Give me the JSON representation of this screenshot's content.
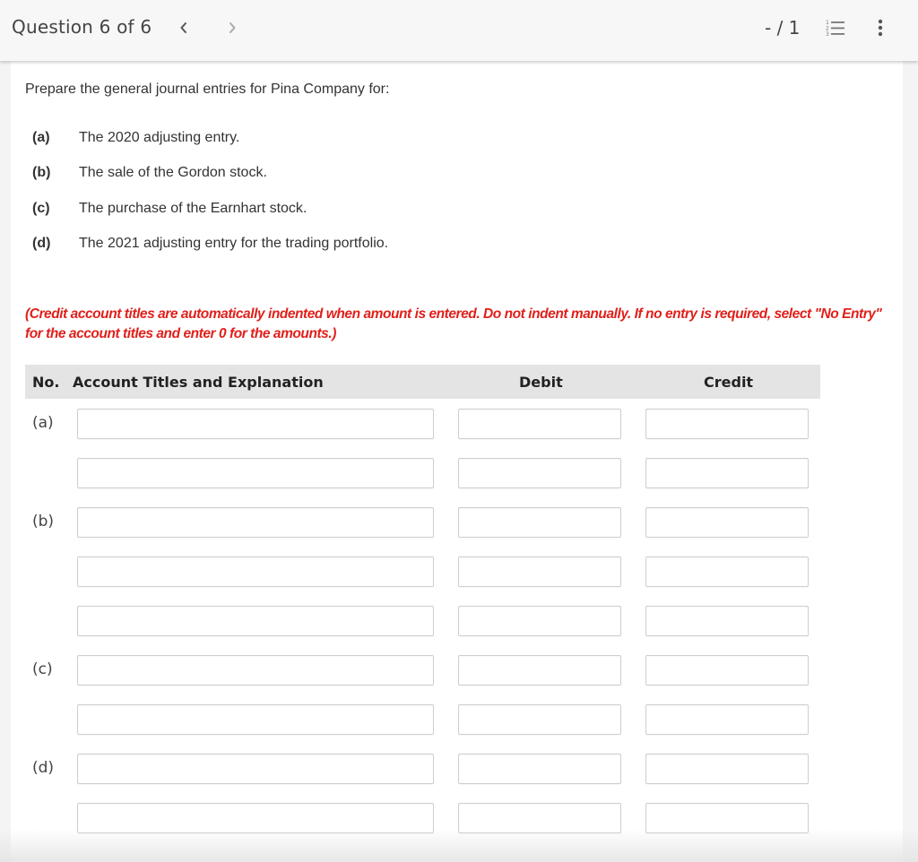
{
  "header": {
    "question_title": "Question 6 of 6",
    "prev_icon": "chevron-left-icon",
    "next_icon": "chevron-right-icon",
    "score": "- / 1",
    "list_icon": "numbered-list-icon",
    "more_icon": "more-vertical-icon"
  },
  "question": {
    "intro": "Prepare the general journal entries for Pina Company for:",
    "parts": [
      {
        "label": "(a)",
        "text": "The 2020 adjusting entry."
      },
      {
        "label": "(b)",
        "text": "The sale of the Gordon stock."
      },
      {
        "label": "(c)",
        "text": "The purchase of the Earnhart stock."
      },
      {
        "label": "(d)",
        "text": "The 2021 adjusting entry for the trading portfolio."
      }
    ],
    "instructions": "(Credit account titles are automatically indented when amount is entered. Do not indent manually. If no entry is required, select \"No Entry\" for the account titles and enter 0 for the amounts.)",
    "instruction_color": "#e0201b"
  },
  "table": {
    "headers": {
      "no": "No.",
      "account": "Account Titles and Explanation",
      "debit": "Debit",
      "credit": "Credit"
    },
    "rows": [
      {
        "no": "(a)",
        "account": "",
        "debit": "",
        "credit": ""
      },
      {
        "no": "",
        "account": "",
        "debit": "",
        "credit": ""
      },
      {
        "no": "(b)",
        "account": "",
        "debit": "",
        "credit": ""
      },
      {
        "no": "",
        "account": "",
        "debit": "",
        "credit": ""
      },
      {
        "no": "",
        "account": "",
        "debit": "",
        "credit": ""
      },
      {
        "no": "(c)",
        "account": "",
        "debit": "",
        "credit": ""
      },
      {
        "no": "",
        "account": "",
        "debit": "",
        "credit": ""
      },
      {
        "no": "(d)",
        "account": "",
        "debit": "",
        "credit": ""
      },
      {
        "no": "",
        "account": "",
        "debit": "",
        "credit": ""
      }
    ]
  }
}
